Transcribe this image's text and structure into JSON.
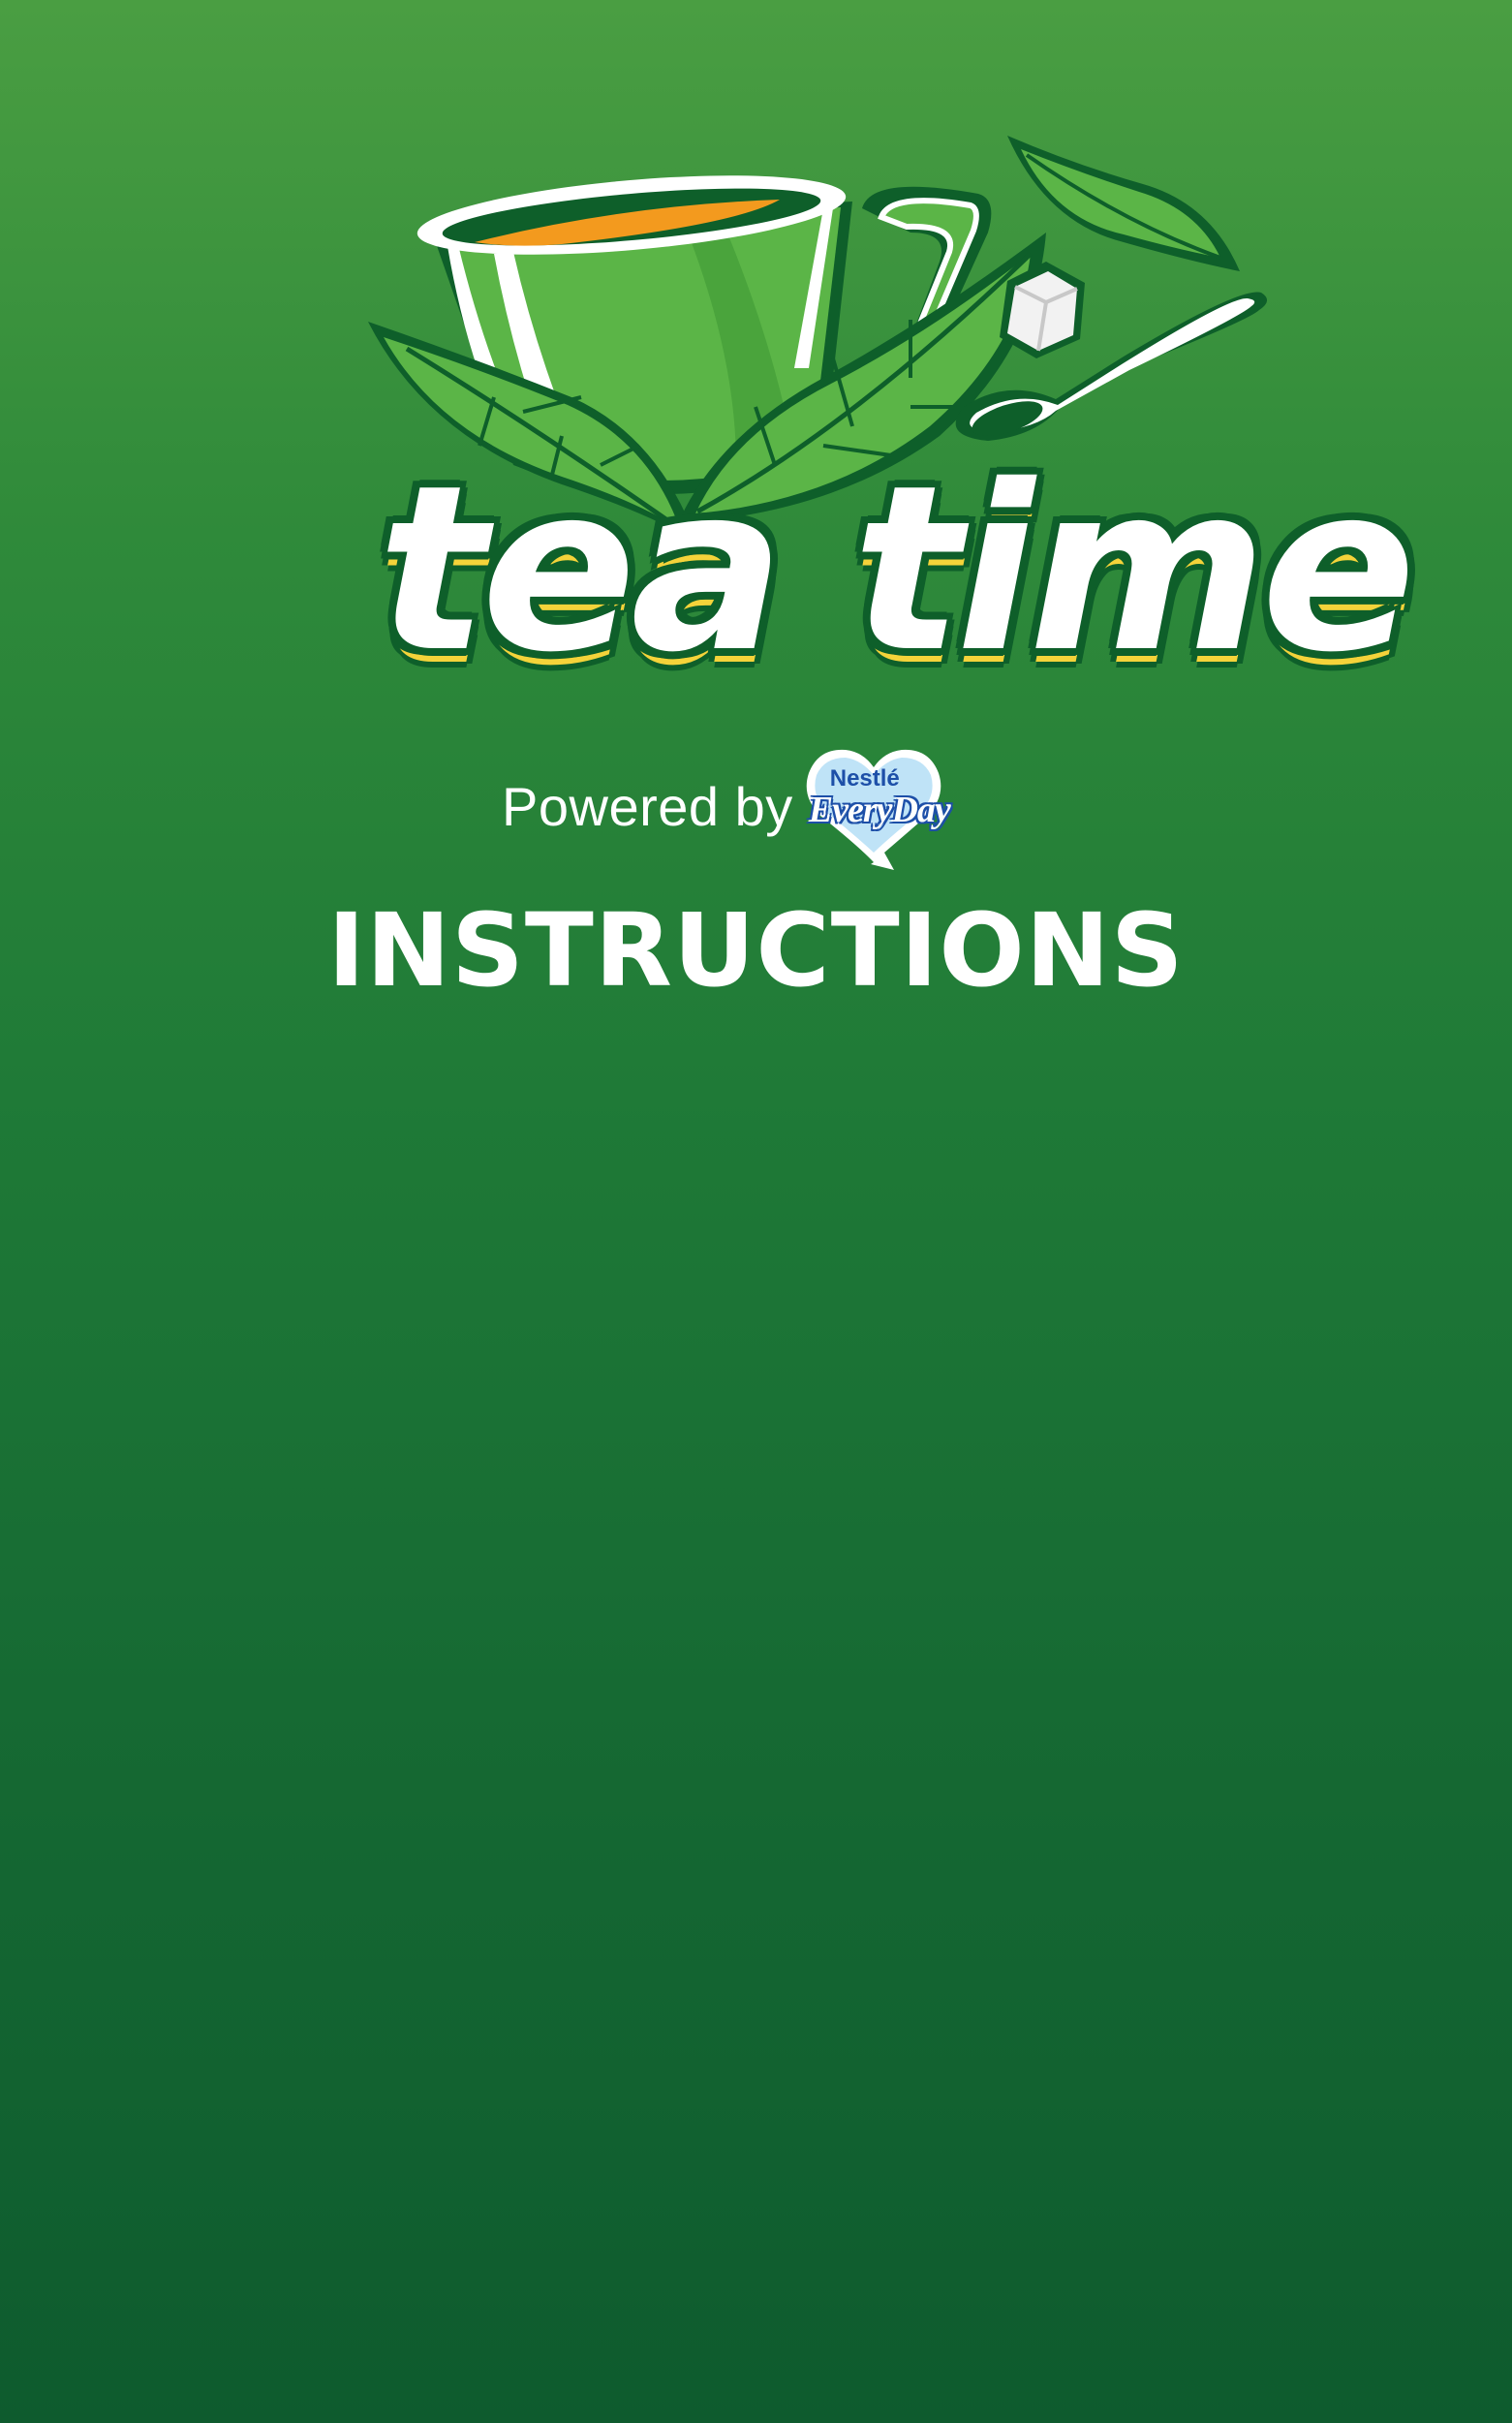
{
  "brand": {
    "title": "tea time",
    "powered_by": "Powered by",
    "partner_brand": "Nestlé",
    "partner_product": "EveryDay"
  },
  "section": {
    "title": "INSTRUCTIONS"
  },
  "icons": [
    "tea-cup-icon",
    "tea-leaf-icon",
    "sugar-cube-icon",
    "spoon-icon",
    "heart-badge-icon"
  ],
  "colors": {
    "background_top": "#4a9e42",
    "background_bottom": "#0e5b2e",
    "leaf_light": "#5bb547",
    "leaf_dark": "#0e5f2a",
    "tea": "#f39a1e",
    "title_shadow": "#f4d33a",
    "badge_blue": "#1d4fa8"
  }
}
